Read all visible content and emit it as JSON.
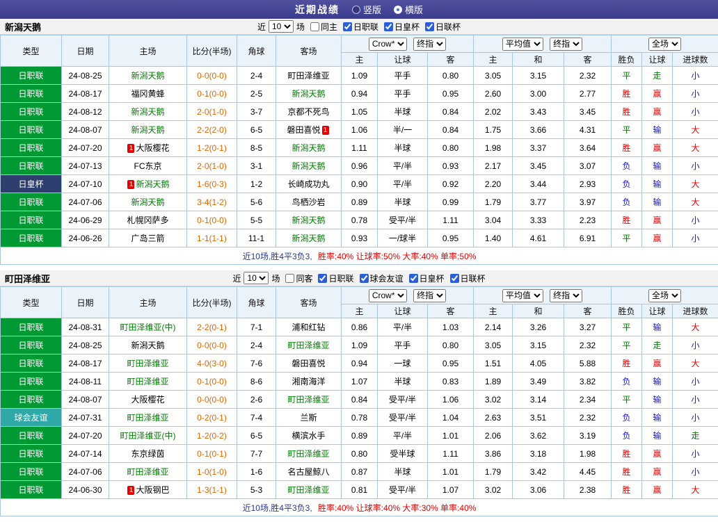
{
  "top_bar": {
    "title": "近期战绩",
    "radios": [
      {
        "label": "竖版",
        "selected": false
      },
      {
        "label": "横版",
        "selected": true
      }
    ]
  },
  "table_header": {
    "static": [
      "类型",
      "日期",
      "主场",
      "比分(半场)",
      "角球",
      "客场"
    ],
    "sub": [
      "主",
      "让球",
      "客",
      "主",
      "和",
      "客",
      "胜负",
      "让球",
      "进球数"
    ],
    "select_crown": "Crow*",
    "select_final1": "终指",
    "select_avg": "平均值",
    "select_final2": "终指",
    "select_full": "全场"
  },
  "colors": {
    "topbar": "#3c3c8e",
    "league_green": "#009933",
    "cup_navy": "#2e3e6e",
    "friendly_teal": "#2fa8a8",
    "accent_green": "#008000",
    "score_orange": "#dd6600",
    "win_red": "#e60000",
    "lose_blue": "#1515cc",
    "summary_navy": "#2b3990"
  },
  "sections": [
    {
      "team": "新潟天鹅",
      "filter": {
        "near": "近",
        "count": "10",
        "games": "场",
        "checkboxes": [
          {
            "label": "同主",
            "checked": false
          },
          {
            "label": "日职联",
            "checked": true
          },
          {
            "label": "日皇杯",
            "checked": true
          },
          {
            "label": "日联杯",
            "checked": true
          }
        ]
      },
      "rows": [
        {
          "league": "日职联",
          "lg": "j1",
          "date": "24-08-25",
          "home": "新潟天鹅",
          "home_hl": true,
          "score": "0-0(0-0)",
          "corner": "2-4",
          "away": "町田泽维亚",
          "odds": [
            "1.09",
            "平手",
            "0.80",
            "3.05",
            "3.15",
            "2.32"
          ],
          "res": [
            "平",
            "走",
            "小"
          ],
          "rc": [
            "g",
            "g",
            "b"
          ]
        },
        {
          "league": "日职联",
          "lg": "j1",
          "date": "24-08-17",
          "home": "福冈黄蜂",
          "score": "0-1(0-0)",
          "corner": "2-5",
          "away": "新潟天鹅",
          "away_hl": true,
          "odds": [
            "0.94",
            "平手",
            "0.95",
            "2.60",
            "3.00",
            "2.77"
          ],
          "res": [
            "胜",
            "赢",
            "小"
          ],
          "rc": [
            "r",
            "r",
            "b"
          ]
        },
        {
          "league": "日职联",
          "lg": "j1",
          "date": "24-08-12",
          "home": "新潟天鹅",
          "home_hl": true,
          "score": "2-0(1-0)",
          "corner": "3-7",
          "away": "京都不死鸟",
          "odds": [
            "1.05",
            "半球",
            "0.84",
            "2.02",
            "3.43",
            "3.45"
          ],
          "res": [
            "胜",
            "赢",
            "小"
          ],
          "rc": [
            "r",
            "r",
            "b"
          ]
        },
        {
          "league": "日职联",
          "lg": "j1",
          "date": "24-08-07",
          "home": "新潟天鹅",
          "home_hl": true,
          "score": "2-2(2-0)",
          "corner": "6-5",
          "away": "磐田喜悦",
          "away_card_post": "1",
          "odds": [
            "1.06",
            "半/一",
            "0.84",
            "1.75",
            "3.66",
            "4.31"
          ],
          "res": [
            "平",
            "输",
            "大"
          ],
          "rc": [
            "g",
            "b",
            "r"
          ]
        },
        {
          "league": "日职联",
          "lg": "j1",
          "date": "24-07-20",
          "home": "大阪樱花",
          "home_card_pre": "1",
          "score": "1-2(0-1)",
          "corner": "8-5",
          "away": "新潟天鹅",
          "away_hl": true,
          "odds": [
            "1.11",
            "半球",
            "0.80",
            "1.98",
            "3.37",
            "3.64"
          ],
          "res": [
            "胜",
            "赢",
            "大"
          ],
          "rc": [
            "r",
            "r",
            "r"
          ]
        },
        {
          "league": "日职联",
          "lg": "j1",
          "date": "24-07-13",
          "home": "FC东京",
          "score": "2-0(1-0)",
          "corner": "3-1",
          "away": "新潟天鹅",
          "away_hl": true,
          "odds": [
            "0.96",
            "平/半",
            "0.93",
            "2.17",
            "3.45",
            "3.07"
          ],
          "res": [
            "负",
            "输",
            "小"
          ],
          "rc": [
            "b",
            "b",
            "b"
          ]
        },
        {
          "league": "日皇杯",
          "lg": "cup",
          "date": "24-07-10",
          "home": "新潟天鹅",
          "home_hl": true,
          "home_card_pre": "1",
          "score": "1-6(0-3)",
          "corner": "1-2",
          "away": "长崎成功丸",
          "odds": [
            "0.90",
            "平/半",
            "0.92",
            "2.20",
            "3.44",
            "2.93"
          ],
          "res": [
            "负",
            "输",
            "大"
          ],
          "rc": [
            "b",
            "b",
            "r"
          ]
        },
        {
          "league": "日职联",
          "lg": "j1",
          "date": "24-07-06",
          "home": "新潟天鹅",
          "home_hl": true,
          "score": "3-4(1-2)",
          "corner": "5-6",
          "away": "鸟栖沙岩",
          "odds": [
            "0.89",
            "半球",
            "0.99",
            "1.79",
            "3.77",
            "3.97"
          ],
          "res": [
            "负",
            "输",
            "大"
          ],
          "rc": [
            "b",
            "b",
            "r"
          ]
        },
        {
          "league": "日职联",
          "lg": "j1",
          "date": "24-06-29",
          "home": "札幌冈萨多",
          "score": "0-1(0-0)",
          "corner": "5-5",
          "away": "新潟天鹅",
          "away_hl": true,
          "odds": [
            "0.78",
            "受平/半",
            "1.11",
            "3.04",
            "3.33",
            "2.23"
          ],
          "res": [
            "胜",
            "赢",
            "小"
          ],
          "rc": [
            "r",
            "r",
            "b"
          ]
        },
        {
          "league": "日职联",
          "lg": "j1",
          "date": "24-06-26",
          "home": "广岛三箭",
          "score": "1-1(1-1)",
          "corner": "11-1",
          "away": "新潟天鹅",
          "away_hl": true,
          "odds": [
            "0.93",
            "一/球半",
            "0.95",
            "1.40",
            "4.61",
            "6.91"
          ],
          "res": [
            "平",
            "赢",
            "小"
          ],
          "rc": [
            "g",
            "r",
            "b"
          ]
        }
      ],
      "summary": {
        "prefix": "近10场,胜4平3负3,",
        "rates": "胜率:40% 让球率:50% 大率:40% 单率:50%"
      }
    },
    {
      "team": "町田泽维亚",
      "filter": {
        "near": "近",
        "count": "10",
        "games": "场",
        "checkboxes": [
          {
            "label": "同客",
            "checked": false
          },
          {
            "label": "日职联",
            "checked": true
          },
          {
            "label": "球会友谊",
            "checked": true
          },
          {
            "label": "日皇杯",
            "checked": true
          },
          {
            "label": "日联杯",
            "checked": true
          }
        ]
      },
      "rows": [
        {
          "league": "日职联",
          "lg": "j1",
          "date": "24-08-31",
          "home": "町田泽维亚(中)",
          "home_hl": true,
          "score": "2-2(0-1)",
          "corner": "7-1",
          "away": "浦和红钻",
          "odds": [
            "0.86",
            "平/半",
            "1.03",
            "2.14",
            "3.26",
            "3.27"
          ],
          "res": [
            "平",
            "输",
            "大"
          ],
          "rc": [
            "g",
            "b",
            "r"
          ]
        },
        {
          "league": "日职联",
          "lg": "j1",
          "date": "24-08-25",
          "home": "新潟天鹅",
          "score": "0-0(0-0)",
          "corner": "2-4",
          "away": "町田泽维亚",
          "away_hl": true,
          "odds": [
            "1.09",
            "平手",
            "0.80",
            "3.05",
            "3.15",
            "2.32"
          ],
          "res": [
            "平",
            "走",
            "小"
          ],
          "rc": [
            "g",
            "g",
            "b"
          ]
        },
        {
          "league": "日职联",
          "lg": "j1",
          "date": "24-08-17",
          "home": "町田泽维亚",
          "home_hl": true,
          "score": "4-0(3-0)",
          "corner": "7-6",
          "away": "磐田喜悦",
          "odds": [
            "0.94",
            "一球",
            "0.95",
            "1.51",
            "4.05",
            "5.88"
          ],
          "res": [
            "胜",
            "赢",
            "大"
          ],
          "rc": [
            "r",
            "r",
            "r"
          ]
        },
        {
          "league": "日职联",
          "lg": "j1",
          "date": "24-08-11",
          "home": "町田泽维亚",
          "home_hl": true,
          "score": "0-1(0-0)",
          "corner": "8-6",
          "away": "湘南海洋",
          "odds": [
            "1.07",
            "半球",
            "0.83",
            "1.89",
            "3.49",
            "3.82"
          ],
          "res": [
            "负",
            "输",
            "小"
          ],
          "rc": [
            "b",
            "b",
            "b"
          ]
        },
        {
          "league": "日职联",
          "lg": "j1",
          "date": "24-08-07",
          "home": "大阪樱花",
          "score": "0-0(0-0)",
          "corner": "2-6",
          "away": "町田泽维亚",
          "away_hl": true,
          "odds": [
            "0.84",
            "受平/半",
            "1.06",
            "3.02",
            "3.14",
            "2.34"
          ],
          "res": [
            "平",
            "输",
            "小"
          ],
          "rc": [
            "g",
            "b",
            "b"
          ]
        },
        {
          "league": "球会友谊",
          "lg": "fr",
          "date": "24-07-31",
          "home": "町田泽维亚",
          "home_hl": true,
          "score": "0-2(0-1)",
          "corner": "7-4",
          "away": "兰斯",
          "odds": [
            "0.78",
            "受平/半",
            "1.04",
            "2.63",
            "3.51",
            "2.32"
          ],
          "res": [
            "负",
            "输",
            "小"
          ],
          "rc": [
            "b",
            "b",
            "b"
          ]
        },
        {
          "league": "日职联",
          "lg": "j1",
          "date": "24-07-20",
          "home": "町田泽维亚(中)",
          "home_hl": true,
          "score": "1-2(0-2)",
          "corner": "6-5",
          "away": "横滨水手",
          "odds": [
            "0.89",
            "平/半",
            "1.01",
            "2.06",
            "3.62",
            "3.19"
          ],
          "res": [
            "负",
            "输",
            "走"
          ],
          "rc": [
            "b",
            "b",
            "g"
          ]
        },
        {
          "league": "日职联",
          "lg": "j1",
          "date": "24-07-14",
          "home": "东京绿茵",
          "score": "0-1(0-1)",
          "corner": "7-7",
          "away": "町田泽维亚",
          "away_hl": true,
          "odds": [
            "0.80",
            "受半球",
            "1.11",
            "3.86",
            "3.18",
            "1.98"
          ],
          "res": [
            "胜",
            "赢",
            "小"
          ],
          "rc": [
            "r",
            "r",
            "b"
          ]
        },
        {
          "league": "日职联",
          "lg": "j1",
          "date": "24-07-06",
          "home": "町田泽维亚",
          "home_hl": true,
          "score": "1-0(1-0)",
          "corner": "1-6",
          "away": "名古屋鲸八",
          "odds": [
            "0.87",
            "半球",
            "1.01",
            "1.79",
            "3.42",
            "4.45"
          ],
          "res": [
            "胜",
            "赢",
            "小"
          ],
          "rc": [
            "r",
            "r",
            "b"
          ]
        },
        {
          "league": "日职联",
          "lg": "j1",
          "date": "24-06-30",
          "home": "大阪钢巴",
          "home_card_pre": "1",
          "score": "1-3(1-1)",
          "corner": "5-3",
          "away": "町田泽维亚",
          "away_hl": true,
          "odds": [
            "0.81",
            "受平/半",
            "1.07",
            "3.02",
            "3.06",
            "2.38"
          ],
          "res": [
            "胜",
            "赢",
            "大"
          ],
          "rc": [
            "r",
            "r",
            "r"
          ]
        }
      ],
      "summary": {
        "prefix": "近10场,胜4平3负3,",
        "rates": "胜率:40% 让球率:40% 大率:30% 单率:40%"
      }
    }
  ]
}
